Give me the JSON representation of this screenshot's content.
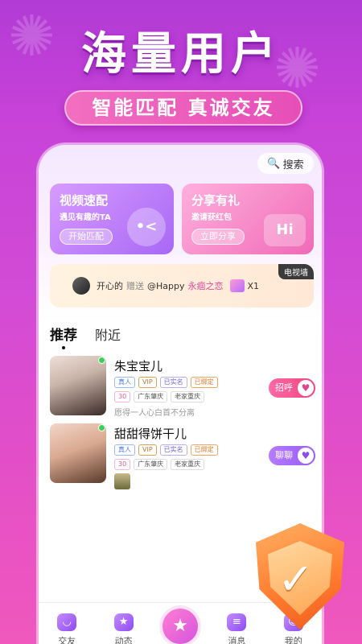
{
  "hero": {
    "title": "海量用户",
    "subtitle": "智能匹配  真诚交友"
  },
  "search": {
    "label": "搜索"
  },
  "cards": [
    {
      "title": "视频速配",
      "desc": "遇见有趣的TA",
      "button": "开始匹配",
      "deco": "•<"
    },
    {
      "title": "分享有礼",
      "desc": "邀请获红包",
      "button": "立即分享",
      "deco": "Hi"
    }
  ],
  "gift_bar": {
    "sender": "开心的",
    "verb": "赠送",
    "receiver": "@Happy",
    "gift": "永痼之恋",
    "count": "X1",
    "tag": "电视墙"
  },
  "tabs": {
    "active": "推荐",
    "other": "附近"
  },
  "users": [
    {
      "name": "朱宝宝儿",
      "badges": [
        "真人",
        "VIP",
        "已实名",
        "已绑定"
      ],
      "tags": [
        "30",
        "广东肇庆",
        "老家重庆"
      ],
      "bio": "愿得一人心白首不分离",
      "action": "招呼"
    },
    {
      "name": "甜甜得饼干儿",
      "badges": [
        "真人",
        "VIP",
        "已实名",
        "已绑定"
      ],
      "tags": [
        "30",
        "广东肇庆",
        "老家重庆"
      ],
      "action": "聊聊"
    }
  ],
  "nav": {
    "items": [
      "交友",
      "动态",
      "消息",
      "我的"
    ]
  },
  "colors": {
    "background_top": "#b23bd6",
    "background_bottom": "#f058bd",
    "accent_pink": "#f0447e",
    "accent_purple": "#9a5cf0",
    "shield_orange": "#ff7a2e"
  }
}
